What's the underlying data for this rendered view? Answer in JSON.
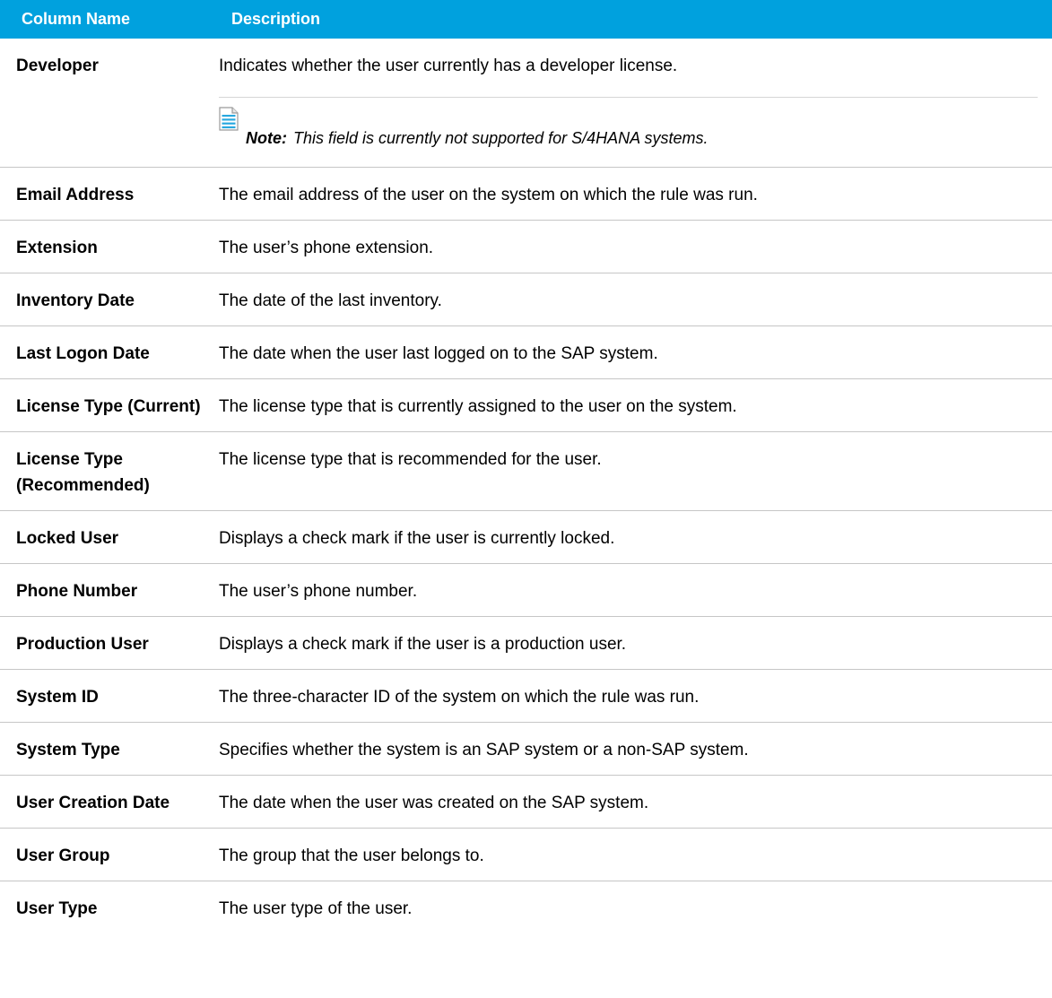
{
  "table": {
    "headers": {
      "column_name": "Column Name",
      "description": "Description"
    },
    "rows": [
      {
        "name": "Developer",
        "description": "Indicates whether the user currently has a developer license.",
        "note": {
          "icon": "note-icon",
          "label": "Note:",
          "text": "This field is currently not supported for S/4HANA systems."
        }
      },
      {
        "name": "Email Address",
        "description": "The email address of the user on the system on which the rule was run."
      },
      {
        "name": "Extension",
        "description": "The user’s phone extension."
      },
      {
        "name": "Inventory Date",
        "description": "The date of the last inventory."
      },
      {
        "name": "Last Logon Date",
        "description": "The date when the user last logged on to the SAP system."
      },
      {
        "name": "License Type (Current)",
        "description": "The license type that is currently assigned to the user on the system."
      },
      {
        "name": "License Type (Recommended)",
        "description": "The license type that is recommended for the user."
      },
      {
        "name": "Locked User",
        "description": "Displays a check mark if the user is currently locked."
      },
      {
        "name": "Phone Number",
        "description": "The user’s phone number."
      },
      {
        "name": "Production User",
        "description": "Displays a check mark if the user is a production user."
      },
      {
        "name": "System ID",
        "description": "The three-character ID of the system on which the rule was run."
      },
      {
        "name": "System Type",
        "description": "Specifies whether the system is an SAP system or a non-SAP system."
      },
      {
        "name": "User Creation Date",
        "description": "The date when the user was created on the SAP system."
      },
      {
        "name": "User Group",
        "description": "The group that the user belongs to."
      },
      {
        "name": "User Type",
        "description": "The user type of the user."
      }
    ]
  },
  "colors": {
    "header_background": "#00a1de",
    "header_text": "#ffffff",
    "row_divider": "#c6c6c6",
    "note_icon": "#29a8df"
  }
}
